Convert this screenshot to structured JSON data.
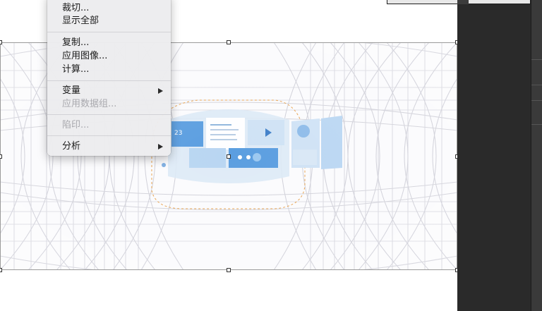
{
  "context_menu": {
    "items": [
      {
        "label": "裁切...",
        "enabled": true
      },
      {
        "label": "显示全部",
        "enabled": true
      },
      {
        "label": "复制...",
        "enabled": true
      },
      {
        "label": "应用图像...",
        "enabled": true
      },
      {
        "label": "计算...",
        "enabled": true
      },
      {
        "label": "变量",
        "enabled": true,
        "submenu": true
      },
      {
        "label": "应用数据组...",
        "enabled": false
      },
      {
        "label": "陷印...",
        "enabled": false
      },
      {
        "label": "分析",
        "enabled": true,
        "submenu": true
      }
    ]
  },
  "colors": {
    "panel_dark": "#2a2a2a",
    "menu_bg": "#ececee",
    "accent_blue": "#4a90d9",
    "guide_orange": "#e8a04a"
  },
  "icons": [
    "submenu-arrow-icon",
    "play-icon",
    "transform-handle"
  ]
}
